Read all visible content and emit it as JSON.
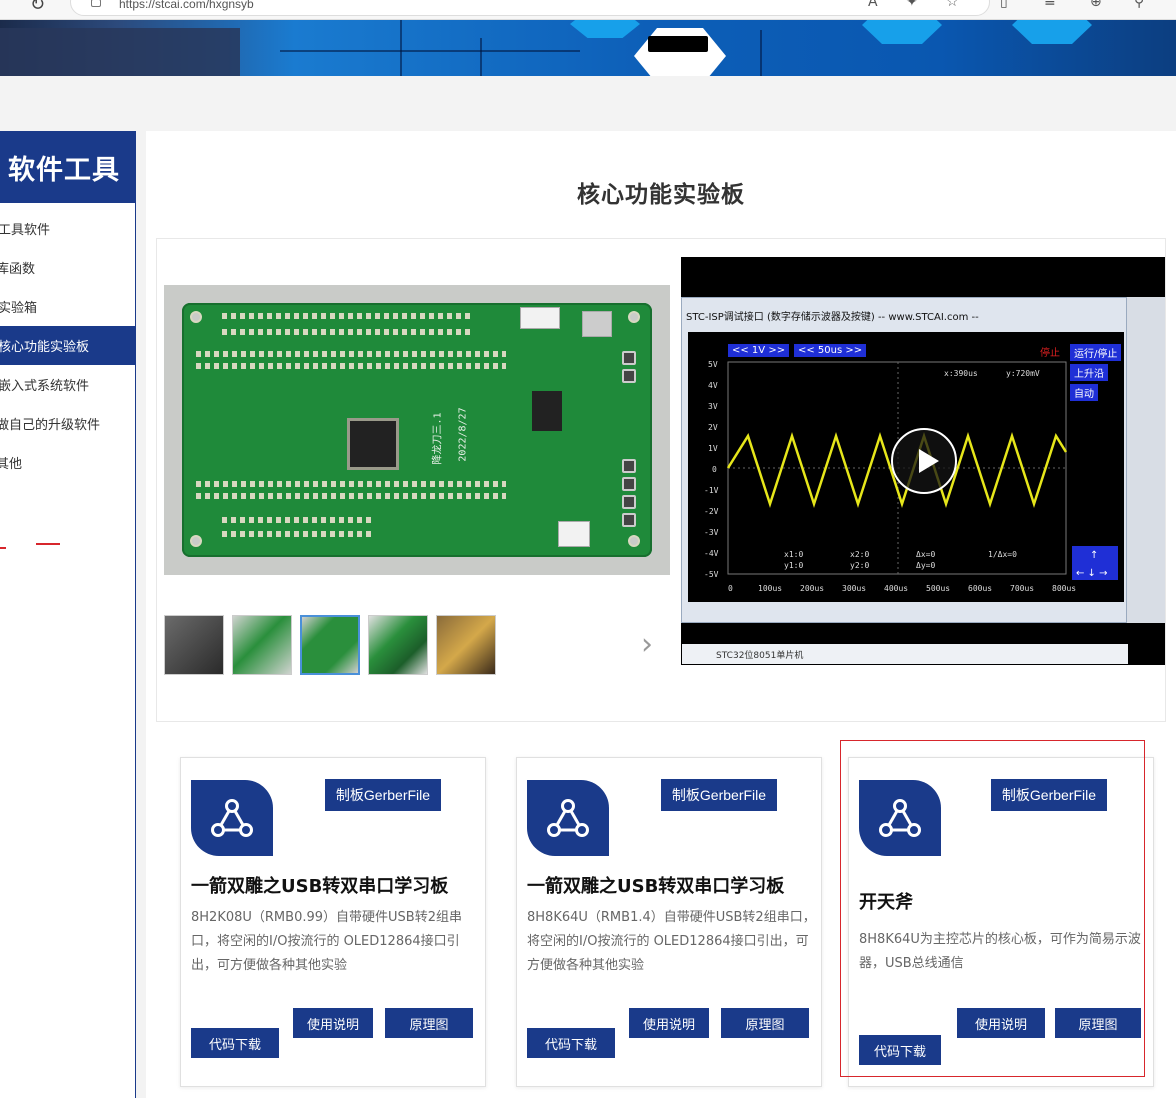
{
  "browser": {
    "url": "https://stcai.com/hxgnsyb"
  },
  "sidebar": {
    "title": "软件工具",
    "items": [
      {
        "label": "工具软件",
        "active": false
      },
      {
        "label": "库函数",
        "active": false
      },
      {
        "label": "实验箱",
        "active": false
      },
      {
        "label": "核心功能实验板",
        "active": true
      },
      {
        "label": "嵌入式系统软件",
        "active": false
      },
      {
        "label": "做自己的升级软件",
        "active": false
      },
      {
        "label": "其他",
        "active": false
      }
    ]
  },
  "main": {
    "title": "核心功能实验板"
  },
  "video": {
    "window_title": "STC-ISP调试接口 (数字存储示波器及按键) -- www.STCAI.com --",
    "volt_btn": "<< 1V >>",
    "time_btn": "<< 50us >>",
    "stop_label": "停止",
    "run_stop": "运行/停止",
    "rising_edge": "上升沿",
    "auto": "自动",
    "cursor_x": "x:390us",
    "cursor_y": "y:720mV",
    "y_ticks": [
      "5V",
      "4V",
      "3V",
      "2V",
      "1V",
      "0",
      "-1V",
      "-2V",
      "-3V",
      "-4V",
      "-5V"
    ],
    "x_ticks": [
      "0",
      "100us",
      "200us",
      "300us",
      "400us",
      "500us",
      "600us",
      "700us",
      "800us"
    ],
    "readouts": [
      "x1:0",
      "y1:0",
      "x2:0",
      "y2:0",
      "Δx=0",
      "Δy=0",
      "1/Δx=0"
    ],
    "bottom_label": "STC32位8051单片机"
  },
  "cards": [
    {
      "gerber": "制板GerberFile",
      "title": "一箭双雕之USB转双串口学习板",
      "desc": "8H2K08U（RMB0.99）自带硬件USB转2组串口，将空闲的I/O按流行的 OLED12864接口引出，可方便做各种其他实验",
      "manual": "使用说明",
      "schematic": "原理图",
      "download": "代码下载"
    },
    {
      "gerber": "制板GerberFile",
      "title": "一箭双雕之USB转双串口学习板",
      "desc": "8H8K64U（RMB1.4）自带硬件USB转2组串口，将空闲的I/O按流行的 OLED12864接口引出，可方便做各种其他实验",
      "manual": "使用说明",
      "schematic": "原理图",
      "download": "代码下载"
    },
    {
      "gerber": "制板GerberFile",
      "title": "开天斧",
      "desc": "8H8K64U为主控芯片的核心板，可作为简易示波器，USB总线通信",
      "manual": "使用说明",
      "schematic": "原理图",
      "download": "代码下载"
    }
  ],
  "colors": {
    "accent": "#1a3a8a",
    "highlight": "#d7262c"
  }
}
